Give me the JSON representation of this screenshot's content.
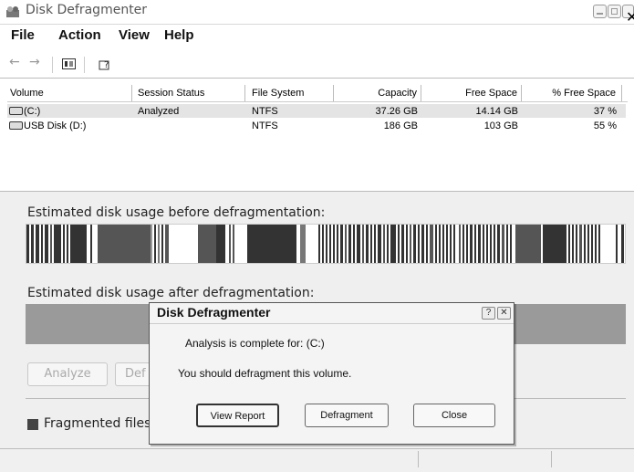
{
  "window": {
    "title": "Disk Defragmenter"
  },
  "menu": [
    "File",
    "Action",
    "View",
    "Help"
  ],
  "toolbar": {
    "back_icon": "back-arrow-icon",
    "forward_icon": "forward-arrow-icon",
    "pane_icon": "show-hide-pane-icon",
    "help_icon": "help-icon"
  },
  "list": {
    "columns": [
      "Volume",
      "Session Status",
      "File System",
      "Capacity",
      "Free Space",
      "% Free Space"
    ],
    "rows": [
      {
        "volume": "(C:)",
        "status": "Analyzed",
        "fs": "NTFS",
        "capacity": "37.26 GB",
        "free": "14.14 GB",
        "pct": "37 %"
      },
      {
        "volume": "USB Disk (D:)",
        "status": "",
        "fs": "NTFS",
        "capacity": "186 GB",
        "free": "103 GB",
        "pct": "55 %"
      }
    ]
  },
  "lower": {
    "before_label": "Estimated disk usage before defragmentation:",
    "after_label": "Estimated disk usage after defragmentation:",
    "analyze_label": "Analyze",
    "defragment_partial": "Def",
    "legend_fragmented": "Fragmented files"
  },
  "dialog": {
    "title": "Disk Defragmenter",
    "help_glyph": "?",
    "close_glyph": "✕",
    "message1": "Analysis is complete for: (C:)",
    "message2": "You should defragment this volume.",
    "view_report": "View Report",
    "defragment": "Defragment",
    "close": "Close"
  },
  "colors": {
    "fragmented": "#444444",
    "contiguous": "#777777",
    "free": "#ffffff"
  }
}
